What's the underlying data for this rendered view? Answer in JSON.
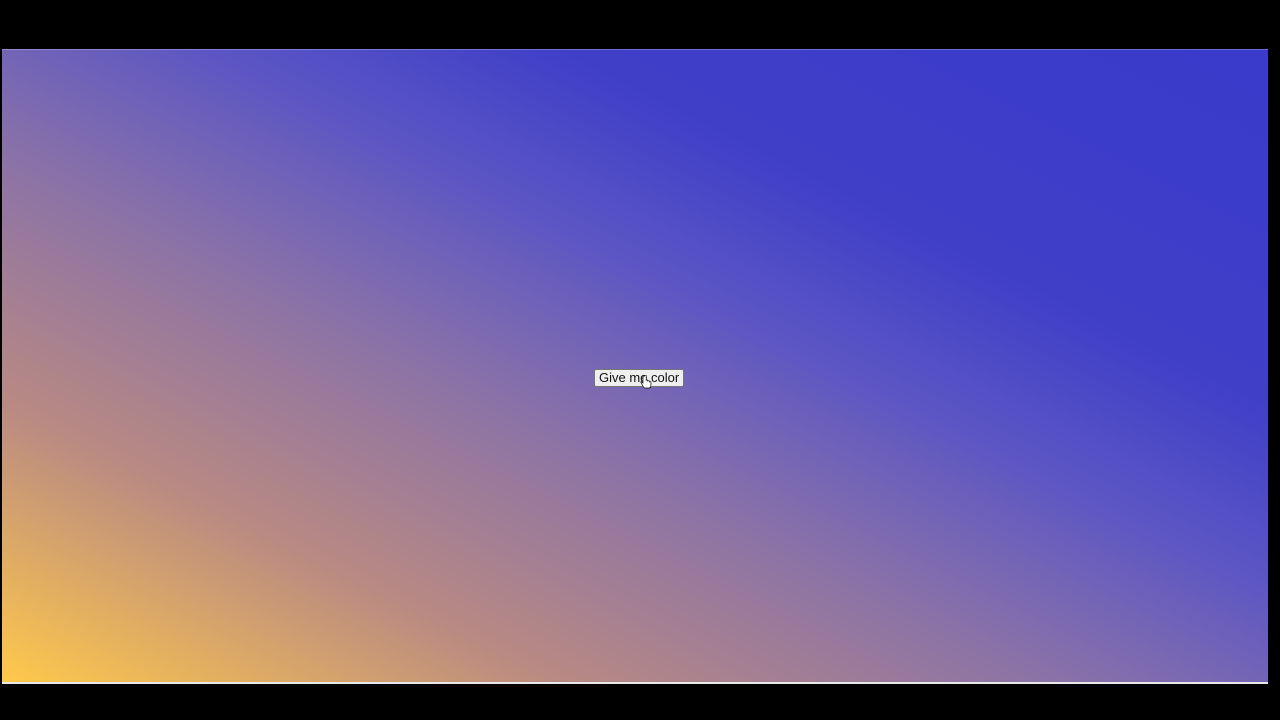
{
  "page": {
    "button_label": "Give me color",
    "gradient_colors": [
      "#ffc94a",
      "#b98a82",
      "#8a72a8",
      "#5c56c4",
      "#3f3fc8",
      "#3a3acb"
    ],
    "frame_color": "#000000"
  },
  "icons": {
    "cursor": "hand-pointer-cursor-icon"
  }
}
